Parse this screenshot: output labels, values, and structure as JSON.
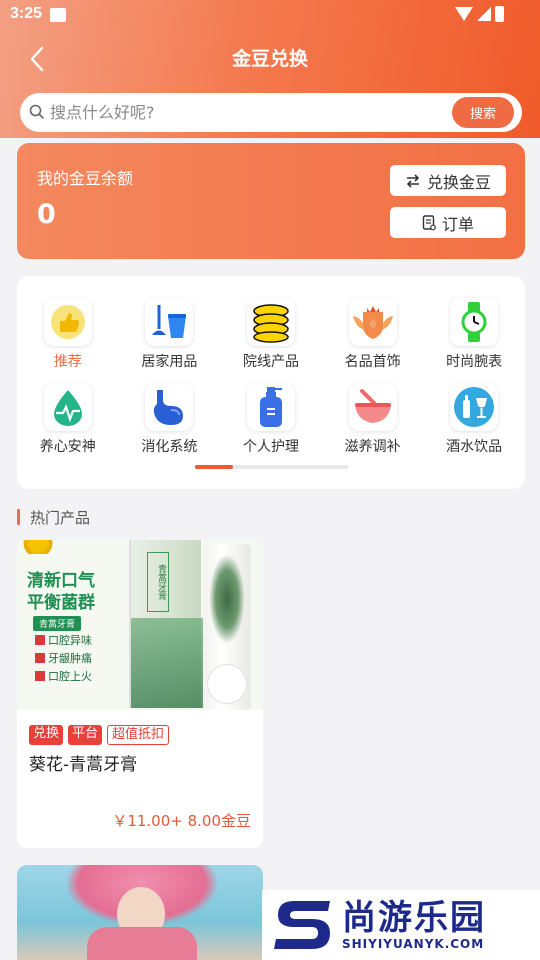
{
  "status_bar": {
    "time": "3:25"
  },
  "header": {
    "title": "金豆兑换",
    "search_placeholder": "搜点什么好呢?",
    "search_button": "搜索"
  },
  "balance": {
    "label": "我的金豆余额",
    "value": "0",
    "exchange_button": "兑换金豆",
    "order_button": "订单"
  },
  "categories": {
    "items": [
      {
        "label": "推荐",
        "icon": "thumbs-up-icon",
        "active": true
      },
      {
        "label": "居家用品",
        "icon": "mop-bucket-icon",
        "active": false
      },
      {
        "label": "院线产品",
        "icon": "coins-icon",
        "active": false
      },
      {
        "label": "名品首饰",
        "icon": "crown-shield-icon",
        "active": false
      },
      {
        "label": "时尚腕表",
        "icon": "watch-icon",
        "active": false
      },
      {
        "label": "养心安神",
        "icon": "heartbeat-drop-icon",
        "active": false
      },
      {
        "label": "消化系统",
        "icon": "stomach-icon",
        "active": false
      },
      {
        "label": "个人护理",
        "icon": "lotion-bottle-icon",
        "active": false
      },
      {
        "label": "滋养调补",
        "icon": "mortar-bowl-icon",
        "active": false
      },
      {
        "label": "酒水饮品",
        "icon": "drinks-icon",
        "active": false
      }
    ],
    "page_indicator_fraction": 0.25
  },
  "section": {
    "title": "热门产品"
  },
  "products": [
    {
      "name": "葵花-青蒿牙膏",
      "tags": [
        "兑换",
        "平台",
        "超值抵扣"
      ],
      "price": "￥11.00+ 8.00金豆",
      "image": {
        "headline_1": "清新口气",
        "headline_2": "平衡菌群",
        "sub_badge": "青蒿牙膏",
        "benefits": [
          "口腔异味",
          "牙龈肿痛",
          "口腔上火"
        ],
        "box_label": "青蒿牙膏"
      }
    }
  ],
  "watermark": {
    "cn": "尚游乐园",
    "en": "SHIYIYUANYK.COM"
  },
  "colors": {
    "accent": "#ef6b43",
    "tag_red": "#e8403a",
    "price": "#e45a3a",
    "brand_blue": "#1d2a8c"
  }
}
